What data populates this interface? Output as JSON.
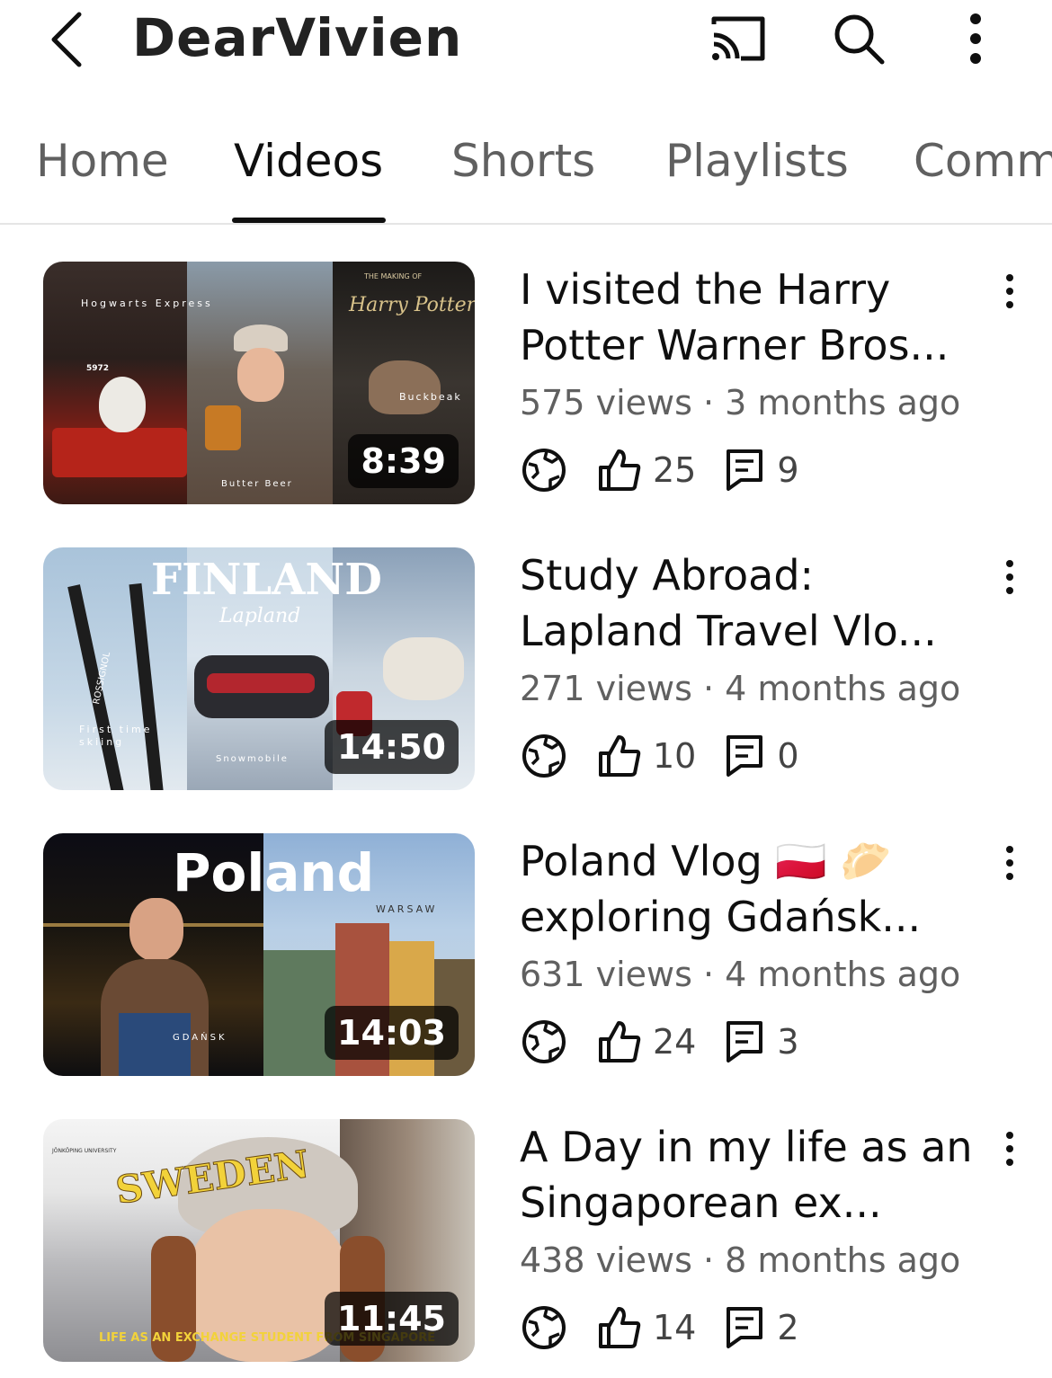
{
  "header": {
    "channel_title": "DearVivien",
    "icons": [
      "back-arrow-icon",
      "cast-icon",
      "search-icon",
      "more-vertical-icon"
    ]
  },
  "tabs": [
    {
      "label": "Home",
      "active": false
    },
    {
      "label": "Videos",
      "active": true
    },
    {
      "label": "Shorts",
      "active": false
    },
    {
      "label": "Playlists",
      "active": false
    },
    {
      "label": "Comm",
      "active": false
    }
  ],
  "videos": [
    {
      "title": "I visited the Harry Potter Warner Bros...",
      "meta": "575 views · 3 months ago",
      "likes": "25",
      "comments": "9",
      "duration": "8:39",
      "thumb_text": [
        "Hogwarts Express",
        "5972",
        "THE MAKING OF",
        "Harry Potter",
        "Buckbeak",
        "Butter Beer"
      ]
    },
    {
      "title": "Study Abroad: Lapland Travel Vlo...",
      "meta": "271 views · 4 months ago",
      "likes": "10",
      "comments": "0",
      "duration": "14:50",
      "thumb_text": [
        "FINLAND",
        "Lapland",
        "First time skiing",
        "Snowmobile",
        "ROSSIGNOL"
      ]
    },
    {
      "title": "Poland Vlog 🇵🇱 🥟 exploring Gdańsk...",
      "meta": "631 views · 4 months ago",
      "likes": "24",
      "comments": "3",
      "duration": "14:03",
      "thumb_text": [
        "Poland",
        "WARSAW",
        "GDAŃSK"
      ]
    },
    {
      "title": "A Day in my life as an Singaporean ex...",
      "meta": "438 views · 8 months ago",
      "likes": "14",
      "comments": "2",
      "duration": "11:45",
      "thumb_text": [
        "JÖNKÖPING UNIVERSITY",
        "SWEDEN",
        "LIFE AS AN EXCHANGE STUDENT FROM SINGAPORE"
      ]
    }
  ],
  "colors": {
    "text_primary": "#0f0f0f",
    "text_secondary": "#606060",
    "divider": "#e5e5e5"
  }
}
